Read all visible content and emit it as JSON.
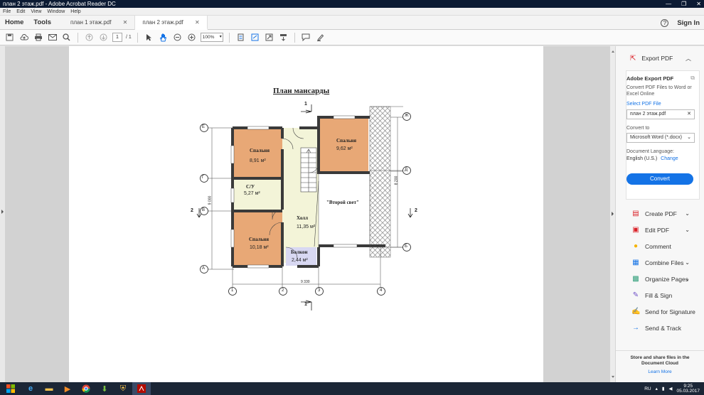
{
  "window": {
    "title": "план 2 этаж.pdf - Adobe Acrobat Reader DC",
    "controls": [
      "—",
      "❐",
      "✕"
    ]
  },
  "menu": [
    "File",
    "Edit",
    "View",
    "Window",
    "Help"
  ],
  "nav": {
    "home": "Home",
    "tools": "Tools",
    "help": "?",
    "signin": "Sign In"
  },
  "tabs": [
    {
      "label": "план 1 этаж.pdf",
      "close": "✕"
    },
    {
      "label": "план 2 этаж.pdf",
      "close": "✕"
    }
  ],
  "toolbar": {
    "page_current": "1",
    "page_total": "/ 1",
    "zoom": "100%"
  },
  "floorplan": {
    "title": "План мансарды",
    "rooms": [
      {
        "name": "Спальня",
        "area": "8,91 м²"
      },
      {
        "name": "Спальня",
        "area": "9,62 м²"
      },
      {
        "name": "С/У",
        "area": "5,27 м²"
      },
      {
        "name": "Холл",
        "area": "11,35 м²"
      },
      {
        "name": "Спальня",
        "area": "10,18 м²"
      },
      {
        "name": "Балкон",
        "area": "2,44 м²"
      }
    ],
    "second_light": "\"Второй свет\"",
    "axes_rows": [
      "Е",
      "Г",
      "В",
      "А"
    ],
    "axes_rows_right": [
      "Ж",
      "Д",
      "Б"
    ],
    "axes_cols": [
      "1",
      "2",
      "3",
      "4"
    ],
    "dim_overall": "9 330",
    "dim_left": "9 000",
    "dim_right": "8 200",
    "section_top": "1",
    "section_bottom": "1",
    "section_left": "2",
    "section_right": "2"
  },
  "panel": {
    "export_header": "Export PDF",
    "box_title": "Adobe Export PDF",
    "box_desc": "Convert PDF Files to Word or Excel Online",
    "select_link": "Select PDF File",
    "file_name": "план 2 этаж.pdf",
    "convert_to_label": "Convert to",
    "convert_to_value": "Microsoft Word (*.docx)",
    "lang_label": "Document Language:",
    "lang_value": "English (U.S.)",
    "lang_change": "Change",
    "convert_button": "Convert",
    "tools": [
      {
        "label": "Create PDF",
        "icon": "create-pdf-icon",
        "chevron": true
      },
      {
        "label": "Edit PDF",
        "icon": "edit-pdf-icon",
        "chevron": true
      },
      {
        "label": "Comment",
        "icon": "comment-icon",
        "chevron": false
      },
      {
        "label": "Combine Files",
        "icon": "combine-files-icon",
        "chevron": true
      },
      {
        "label": "Organize Pages",
        "icon": "organize-pages-icon",
        "chevron": true
      },
      {
        "label": "Fill & Sign",
        "icon": "fill-sign-icon",
        "chevron": false
      },
      {
        "label": "Send for Signature",
        "icon": "send-signature-icon",
        "chevron": false
      },
      {
        "label": "Send & Track",
        "icon": "send-track-icon",
        "chevron": false
      }
    ],
    "footer_line1": "Store and share files in the",
    "footer_line2": "Document Cloud",
    "footer_link": "Learn More"
  },
  "taskbar": {
    "lang": "RU",
    "time": "9:25",
    "date": "05.03.2017"
  }
}
